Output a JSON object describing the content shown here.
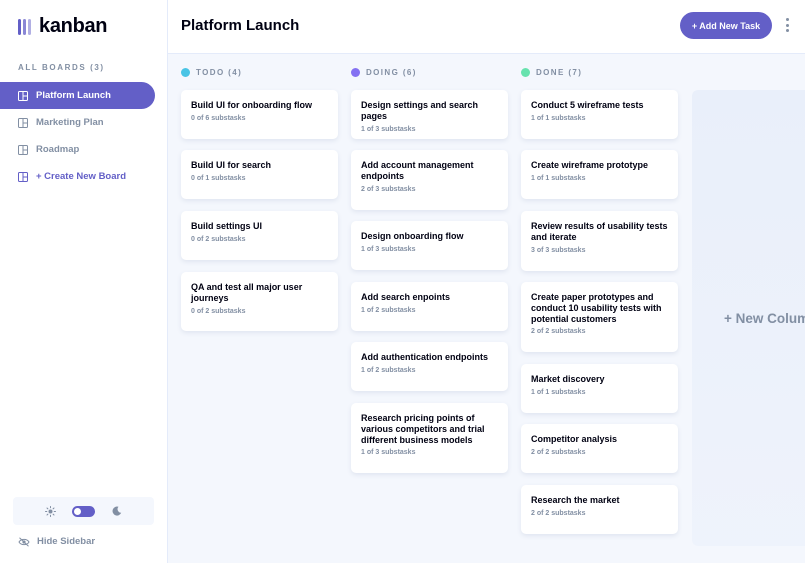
{
  "app": {
    "logo_text": "kanban"
  },
  "sidebar": {
    "boards_heading": "ALL BOARDS (3)",
    "boards": [
      {
        "label": "Platform Launch",
        "active": true
      },
      {
        "label": "Marketing Plan",
        "active": false
      },
      {
        "label": "Roadmap",
        "active": false
      }
    ],
    "create_label": "+ Create New Board",
    "hide_label": "Hide Sidebar"
  },
  "header": {
    "title": "Platform Launch",
    "add_task_label": "+ Add New Task"
  },
  "columns": [
    {
      "heading": "TODO (4)",
      "dot_color": "#49C4E5",
      "tasks": [
        {
          "title": "Build UI for onboarding flow",
          "subtasks": "0 of 6 substasks"
        },
        {
          "title": "Build UI for search",
          "subtasks": "0 of 1 substasks"
        },
        {
          "title": "Build settings UI",
          "subtasks": "0 of 2 substasks"
        },
        {
          "title": "QA and test all major user journeys",
          "subtasks": "0 of 2 substasks"
        }
      ]
    },
    {
      "heading": "DOING (6)",
      "dot_color": "#8471F2",
      "tasks": [
        {
          "title": "Design settings and search pages",
          "subtasks": "1 of 3 substasks"
        },
        {
          "title": "Add account management endpoints",
          "subtasks": "2 of 3 substasks"
        },
        {
          "title": "Design onboarding flow",
          "subtasks": "1 of 3 substasks"
        },
        {
          "title": "Add search enpoints",
          "subtasks": "1 of 2 substasks"
        },
        {
          "title": "Add authentication endpoints",
          "subtasks": "1 of 2 substasks"
        },
        {
          "title": "Research pricing points of various competitors and trial different business models",
          "subtasks": "1 of 3 substasks"
        }
      ]
    },
    {
      "heading": "DONE (7)",
      "dot_color": "#67E2AE",
      "tasks": [
        {
          "title": "Conduct 5 wireframe tests",
          "subtasks": "1 of 1 substasks"
        },
        {
          "title": "Create wireframe prototype",
          "subtasks": "1 of 1 substasks"
        },
        {
          "title": "Review results of usability tests and iterate",
          "subtasks": "3 of 3 substasks"
        },
        {
          "title": "Create paper prototypes and conduct 10 usability tests with potential customers",
          "subtasks": "2 of 2 substasks"
        },
        {
          "title": "Market discovery",
          "subtasks": "1 of 1 substasks"
        },
        {
          "title": "Competitor analysis",
          "subtasks": "2 of 2 substasks"
        },
        {
          "title": "Research the market",
          "subtasks": "2 of 2 substasks"
        }
      ]
    }
  ],
  "new_column_label": "+ New Column",
  "colors": {
    "accent": "#635FC7",
    "muted": "#828FA3",
    "background": "#F4F7FD"
  },
  "icons": {
    "theme_light": "sun-icon",
    "theme_dark": "moon-icon",
    "hide": "eye-slash-icon",
    "board": "board-icon"
  }
}
